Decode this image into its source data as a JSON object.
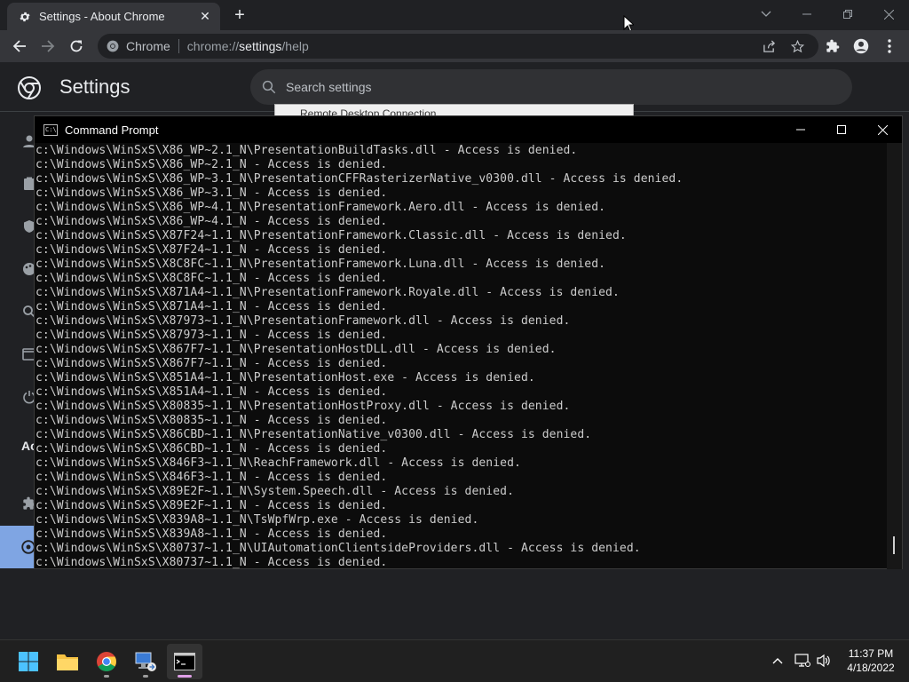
{
  "chrome": {
    "tab_title": "Settings - About Chrome",
    "site_label": "Chrome",
    "url_scheme": "chrome://",
    "url_host": "settings",
    "url_path": "/help"
  },
  "settings": {
    "title": "Settings",
    "search_placeholder": "Search settings",
    "side_section_label": "Ac"
  },
  "rdp": {
    "title": "Remote Desktop Connection"
  },
  "cmd": {
    "title": "Command Prompt",
    "lines": [
      "c:\\Windows\\WinSxS\\X86_WP~2.1_N\\PresentationBuildTasks.dll - Access is denied.",
      "c:\\Windows\\WinSxS\\X86_WP~2.1_N - Access is denied.",
      "c:\\Windows\\WinSxS\\X86_WP~3.1_N\\PresentationCFFRasterizerNative_v0300.dll - Access is denied.",
      "c:\\Windows\\WinSxS\\X86_WP~3.1_N - Access is denied.",
      "c:\\Windows\\WinSxS\\X86_WP~4.1_N\\PresentationFramework.Aero.dll - Access is denied.",
      "c:\\Windows\\WinSxS\\X86_WP~4.1_N - Access is denied.",
      "c:\\Windows\\WinSxS\\X87F24~1.1_N\\PresentationFramework.Classic.dll - Access is denied.",
      "c:\\Windows\\WinSxS\\X87F24~1.1_N - Access is denied.",
      "c:\\Windows\\WinSxS\\X8C8FC~1.1_N\\PresentationFramework.Luna.dll - Access is denied.",
      "c:\\Windows\\WinSxS\\X8C8FC~1.1_N - Access is denied.",
      "c:\\Windows\\WinSxS\\X871A4~1.1_N\\PresentationFramework.Royale.dll - Access is denied.",
      "c:\\Windows\\WinSxS\\X871A4~1.1_N - Access is denied.",
      "c:\\Windows\\WinSxS\\X87973~1.1_N\\PresentationFramework.dll - Access is denied.",
      "c:\\Windows\\WinSxS\\X87973~1.1_N - Access is denied.",
      "c:\\Windows\\WinSxS\\X867F7~1.1_N\\PresentationHostDLL.dll - Access is denied.",
      "c:\\Windows\\WinSxS\\X867F7~1.1_N - Access is denied.",
      "c:\\Windows\\WinSxS\\X851A4~1.1_N\\PresentationHost.exe - Access is denied.",
      "c:\\Windows\\WinSxS\\X851A4~1.1_N - Access is denied.",
      "c:\\Windows\\WinSxS\\X80835~1.1_N\\PresentationHostProxy.dll - Access is denied.",
      "c:\\Windows\\WinSxS\\X80835~1.1_N - Access is denied.",
      "c:\\Windows\\WinSxS\\X86CBD~1.1_N\\PresentationNative_v0300.dll - Access is denied.",
      "c:\\Windows\\WinSxS\\X86CBD~1.1_N - Access is denied.",
      "c:\\Windows\\WinSxS\\X846F3~1.1_N\\ReachFramework.dll - Access is denied.",
      "c:\\Windows\\WinSxS\\X846F3~1.1_N - Access is denied.",
      "c:\\Windows\\WinSxS\\X89E2F~1.1_N\\System.Speech.dll - Access is denied.",
      "c:\\Windows\\WinSxS\\X89E2F~1.1_N - Access is denied.",
      "c:\\Windows\\WinSxS\\X839A8~1.1_N\\TsWpfWrp.exe - Access is denied.",
      "c:\\Windows\\WinSxS\\X839A8~1.1_N - Access is denied.",
      "c:\\Windows\\WinSxS\\X80737~1.1_N\\UIAutomationClientsideProviders.dll - Access is denied.",
      "c:\\Windows\\WinSxS\\X80737~1.1_N - Access is denied."
    ]
  },
  "taskbar": {
    "apps": [
      "start-icon",
      "file-explorer-icon",
      "chrome-icon",
      "remote-desktop-icon",
      "command-prompt-icon"
    ],
    "time": "11:37 PM",
    "date": "4/18/2022"
  },
  "colors": {
    "cmd_text": "#cccccc",
    "cmd_background": "#0c0c0c",
    "chrome_dark": "#202124",
    "chrome_toolbar": "#35363a",
    "accent_blue": "#8ab4f8"
  }
}
